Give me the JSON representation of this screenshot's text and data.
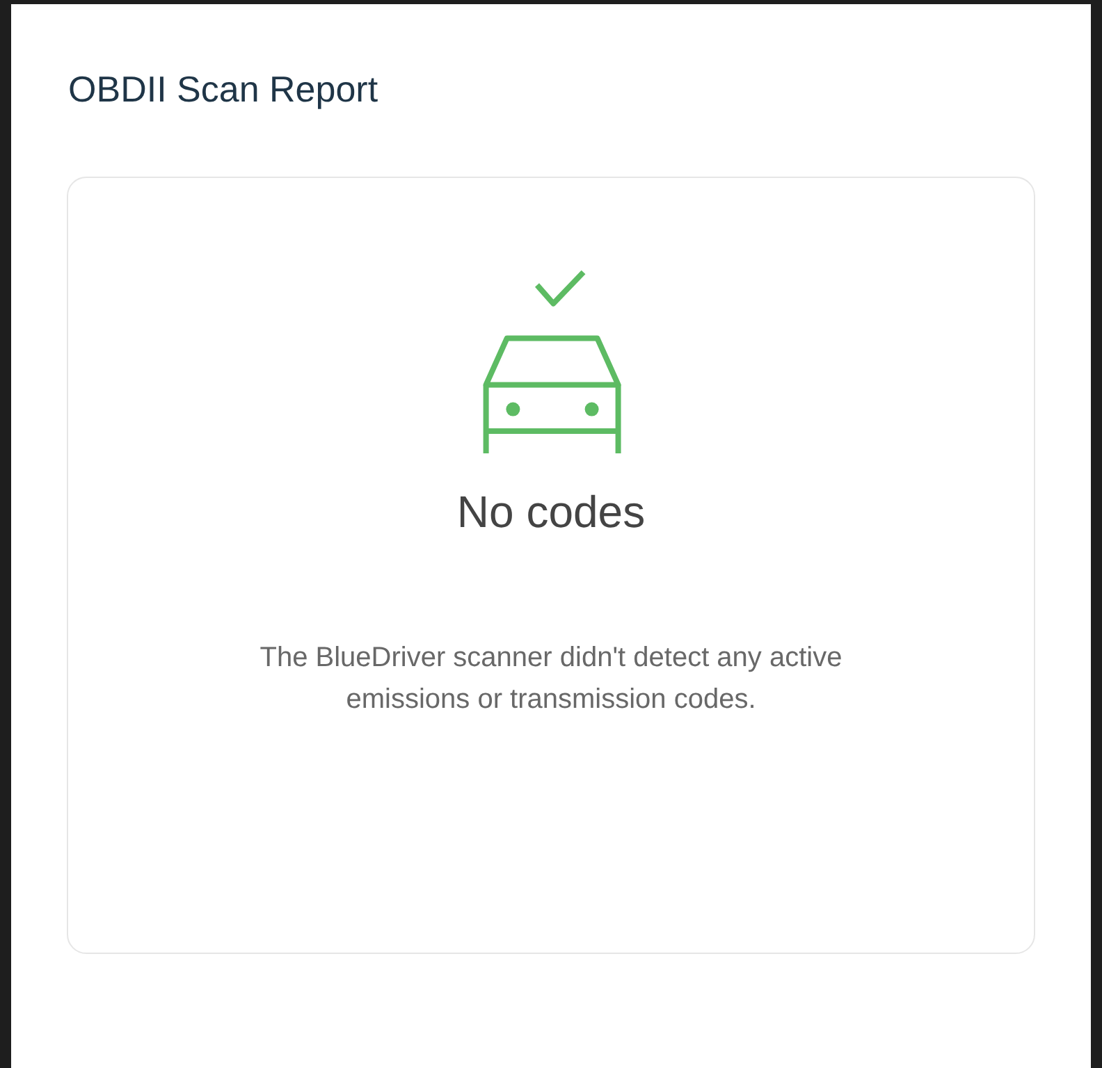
{
  "title": "OBDII Scan Report",
  "result": {
    "heading": "No codes",
    "message": "The BlueDriver scanner didn't detect any active emissions or transmission codes."
  }
}
